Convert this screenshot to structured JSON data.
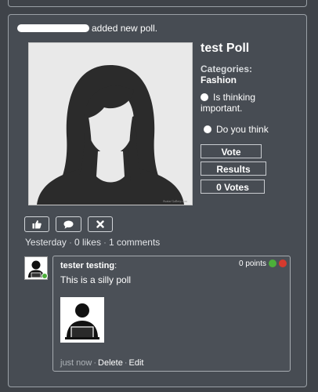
{
  "post": {
    "action_text": "added new poll.",
    "poll": {
      "title": "test Poll",
      "categories_label": "Categories:",
      "category": "Fashion",
      "options": [
        "Is thinking important.",
        "Do you think"
      ],
      "vote_label": "Vote",
      "results_label": "Results",
      "votes_label": "0 Votes",
      "image_watermark": "Avatar Gallery.com"
    },
    "actions": {
      "like_icon": "thumbs-up-icon",
      "comment_icon": "speech-bubble-icon",
      "close_icon": "x-icon"
    },
    "meta": {
      "time": "Yesterday",
      "likes": "0 likes",
      "comments": "1 comments",
      "separator": "·"
    }
  },
  "comment": {
    "author": "tester testing",
    "colon": ":",
    "points": "0 points",
    "text": "This is a silly poll",
    "time": "just now",
    "delete_label": "Delete",
    "edit_label": "Edit",
    "separator": "·",
    "up_color": "#4caf3a",
    "down_color": "#d63a2e"
  }
}
